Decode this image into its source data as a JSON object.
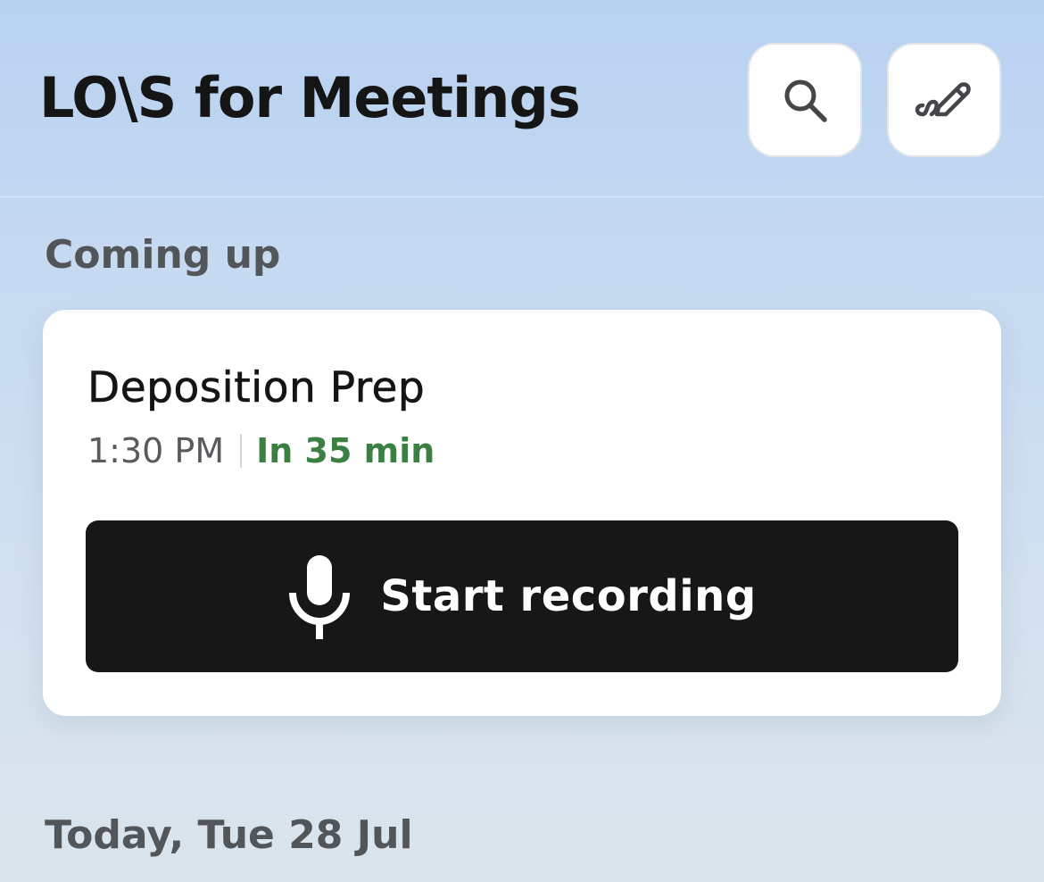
{
  "header": {
    "logo_text": "LO\\S for Meetings",
    "search_icon": "search-icon",
    "compose_icon": "compose-pen-icon"
  },
  "upcoming": {
    "section_title": "Coming up",
    "meeting": {
      "title": "Deposition Prep",
      "time": "1:30 PM",
      "relative_time": "In 35 min"
    },
    "record_button": {
      "label": "Start recording",
      "icon": "microphone-icon"
    }
  },
  "today": {
    "section_title": "Today, Tue 28 Jul"
  },
  "colors": {
    "accent_green": "#3a8043",
    "button_dark": "#171717",
    "background_top": "#b8d1f1",
    "background_bottom": "#dbe4ec"
  }
}
